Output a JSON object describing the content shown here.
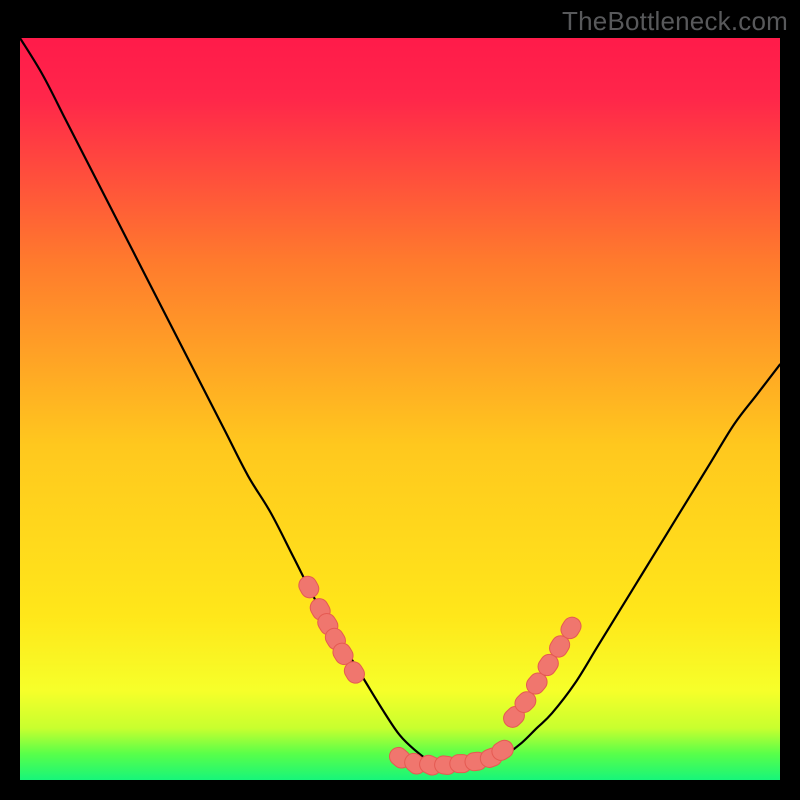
{
  "watermark": "TheBottleneck.com",
  "colors": {
    "bg": "#000000",
    "top": "#ff1b4a",
    "mid": "#ffd400",
    "low_yellow": "#faff3c",
    "lime": "#b8ff2e",
    "green": "#17f57a",
    "curve": "#000000",
    "marker_fill": "#f0766e",
    "marker_stroke": "#e55a52"
  },
  "chart_data": {
    "type": "line",
    "title": "",
    "xlabel": "",
    "ylabel": "",
    "xlim": [
      0,
      100
    ],
    "ylim": [
      0,
      100
    ],
    "series": [
      {
        "name": "bottleneck-curve",
        "x": [
          0,
          3,
          6,
          9,
          12,
          15,
          18,
          21,
          24,
          27,
          30,
          33,
          36,
          39,
          42,
          45,
          48,
          50,
          52,
          54,
          56,
          58,
          60,
          62,
          64,
          66,
          68,
          70,
          73,
          76,
          79,
          82,
          85,
          88,
          91,
          94,
          97,
          100
        ],
        "y": [
          100,
          95,
          89,
          83,
          77,
          71,
          65,
          59,
          53,
          47,
          41,
          36,
          30,
          24,
          19,
          14,
          9,
          6,
          4,
          2.5,
          2,
          2,
          2,
          2.5,
          3.5,
          5,
          7,
          9,
          13,
          18,
          23,
          28,
          33,
          38,
          43,
          48,
          52,
          56
        ]
      }
    ],
    "markers": [
      {
        "name": "left-cluster",
        "x": [
          38,
          39.5,
          40.5,
          41.5,
          42.5,
          44
        ],
        "y": [
          26,
          23,
          21,
          19,
          17,
          14.5
        ]
      },
      {
        "name": "bottom-cluster",
        "x": [
          50,
          52,
          54,
          56,
          58,
          60,
          62,
          63.5
        ],
        "y": [
          3,
          2.2,
          2,
          2,
          2.2,
          2.5,
          3,
          4
        ]
      },
      {
        "name": "right-cluster",
        "x": [
          65,
          66.5,
          68,
          69.5,
          71,
          72.5
        ],
        "y": [
          8.5,
          10.5,
          13,
          15.5,
          18,
          20.5
        ]
      }
    ],
    "gradient_stops": [
      {
        "pos": 0.0,
        "color": "#ff1b4a"
      },
      {
        "pos": 0.08,
        "color": "#ff264a"
      },
      {
        "pos": 0.3,
        "color": "#ff7a2d"
      },
      {
        "pos": 0.55,
        "color": "#ffc81e"
      },
      {
        "pos": 0.78,
        "color": "#ffe71a"
      },
      {
        "pos": 0.88,
        "color": "#f6ff2a"
      },
      {
        "pos": 0.93,
        "color": "#c8ff2e"
      },
      {
        "pos": 0.965,
        "color": "#58ff4a"
      },
      {
        "pos": 1.0,
        "color": "#17f57a"
      }
    ]
  }
}
